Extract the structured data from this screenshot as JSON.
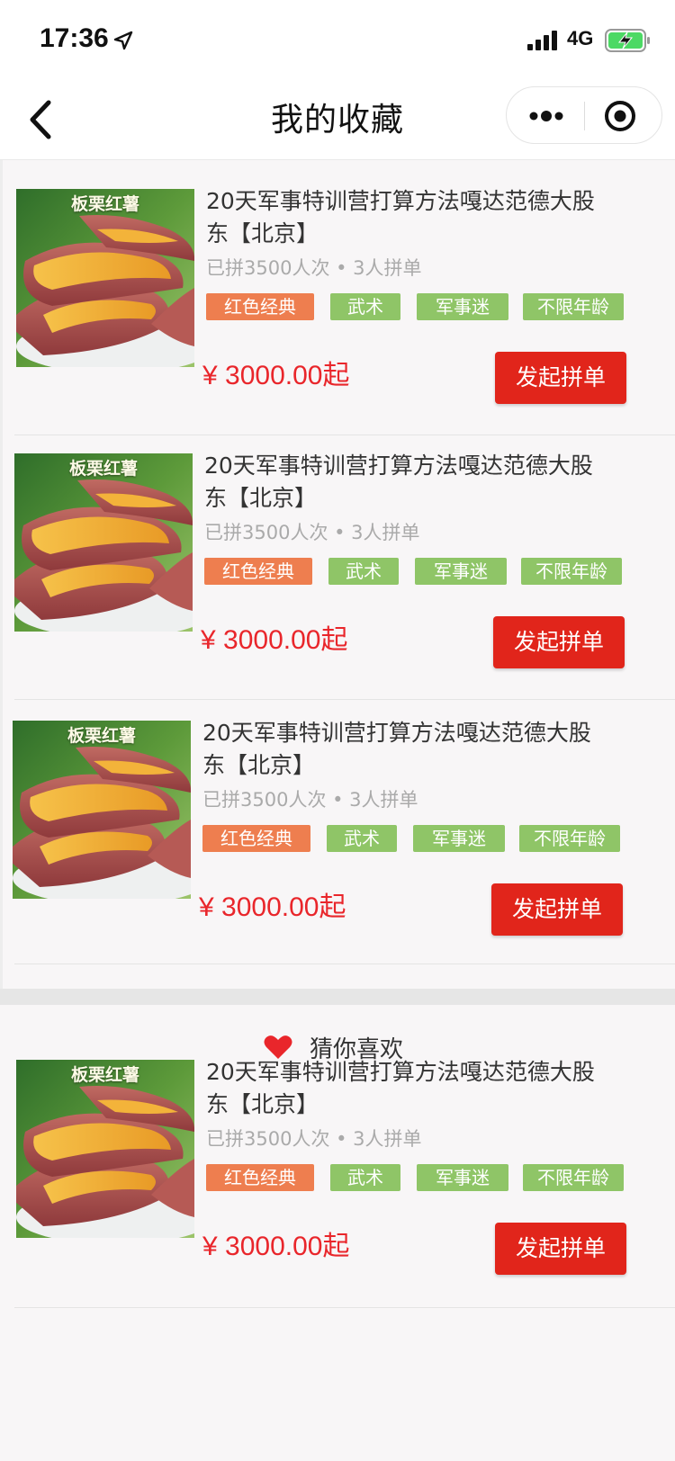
{
  "status_bar": {
    "time": "17:36",
    "network": "4G",
    "icons": [
      "location-arrow-icon",
      "signal-icon",
      "battery-charging-icon"
    ]
  },
  "nav": {
    "title": "我的收藏",
    "icons": [
      "back-icon",
      "more-dots-icon",
      "close-miniprogram-icon"
    ]
  },
  "favorites": [
    {
      "image_caption": "板栗红薯",
      "title": "20天军事特训营打算方法嘎达范德大股东【北京】",
      "meta": "已拼3500人次 • 3人拼单",
      "tags": [
        {
          "label": "红色经典",
          "color": "#ee7e4f"
        },
        {
          "label": "武术",
          "color": "#8fc567"
        },
        {
          "label": "军事迷",
          "color": "#8fc567"
        },
        {
          "label": "不限年龄",
          "color": "#8fc567"
        }
      ],
      "price": "¥ 3000.00起",
      "button": "发起拼单"
    },
    {
      "image_caption": "板栗红薯",
      "title": "20天军事特训营打算方法嘎达范德大股东【北京】",
      "meta": "已拼3500人次 • 3人拼单",
      "tags": [
        {
          "label": "红色经典",
          "color": "#ee7e4f"
        },
        {
          "label": "武术",
          "color": "#8fc567"
        },
        {
          "label": "军事迷",
          "color": "#8fc567"
        },
        {
          "label": "不限年龄",
          "color": "#8fc567"
        }
      ],
      "price": "¥ 3000.00起",
      "button": "发起拼单"
    },
    {
      "image_caption": "板栗红薯",
      "title": "20天军事特训营打算方法嘎达范德大股东【北京】",
      "meta": "已拼3500人次 • 3人拼单",
      "tags": [
        {
          "label": "红色经典",
          "color": "#ee7e4f"
        },
        {
          "label": "武术",
          "color": "#8fc567"
        },
        {
          "label": "军事迷",
          "color": "#8fc567"
        },
        {
          "label": "不限年龄",
          "color": "#8fc567"
        }
      ],
      "price": "¥ 3000.00起",
      "button": "发起拼单"
    }
  ],
  "recommend": {
    "label": "猜你喜欢",
    "icon": "heart-icon",
    "items": [
      {
        "image_caption": "板栗红薯",
        "title": "20天军事特训营打算方法嘎达范德大股东【北京】",
        "meta": "已拼3500人次 • 3人拼单",
        "tags": [
          {
            "label": "红色经典",
            "color": "#ee7e4f"
          },
          {
            "label": "武术",
            "color": "#8fc567"
          },
          {
            "label": "军事迷",
            "color": "#8fc567"
          },
          {
            "label": "不限年龄",
            "color": "#8fc567"
          }
        ],
        "price": "¥ 3000.00起",
        "button": "发起拼单"
      }
    ]
  },
  "colors": {
    "price": "#e9262b",
    "button": "#e1251b",
    "tag_orange": "#ee7e4f",
    "tag_green": "#8fc567",
    "heart": "#e9262b"
  }
}
